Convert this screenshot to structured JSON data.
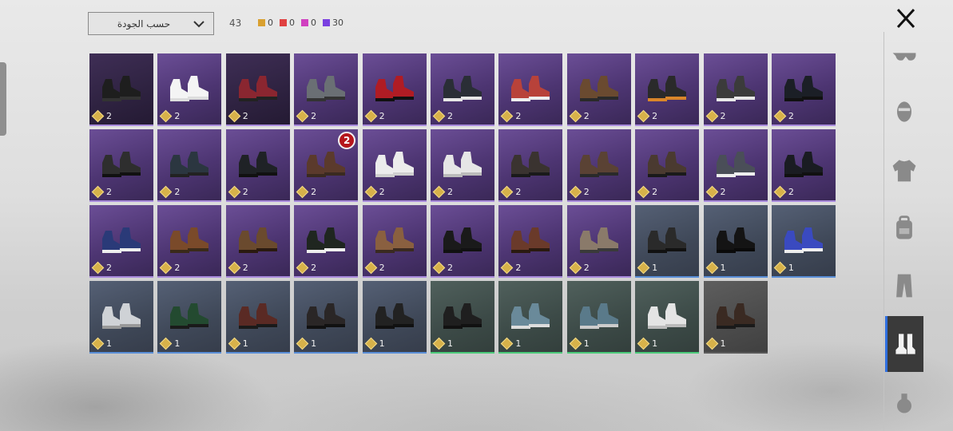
{
  "toolbar": {
    "sort_label": "حسب الجودة",
    "total_count": "43",
    "rarity_counts": [
      {
        "color": "#d9a030",
        "value": "0"
      },
      {
        "color": "#e04040",
        "value": "0"
      },
      {
        "color": "#d040c0",
        "value": "0"
      },
      {
        "color": "#7a40e0",
        "value": "30"
      }
    ]
  },
  "sidebar": {
    "close_icon": "close-icon",
    "categories": [
      {
        "name": "glasses",
        "icon": "glasses-icon",
        "active": false
      },
      {
        "name": "mask",
        "icon": "mask-icon",
        "active": false
      },
      {
        "name": "top",
        "icon": "jacket-icon",
        "active": false
      },
      {
        "name": "backpack",
        "icon": "backpack-icon",
        "active": false
      },
      {
        "name": "pants",
        "icon": "pants-icon",
        "active": false
      },
      {
        "name": "shoes",
        "icon": "shoes-icon",
        "active": true
      },
      {
        "name": "grenade",
        "icon": "grenade-icon",
        "active": false
      }
    ]
  },
  "items": [
    {
      "rarity": "purple-dark",
      "count": "2",
      "color": "#1e1e1e",
      "sole": "#333"
    },
    {
      "rarity": "purple",
      "count": "2",
      "color": "#f4f4f4",
      "sole": "#ddd"
    },
    {
      "rarity": "purple-dark",
      "count": "2",
      "color": "#8a2630",
      "sole": "#222"
    },
    {
      "rarity": "purple",
      "count": "2",
      "color": "#6a6f74",
      "sole": "#333"
    },
    {
      "rarity": "purple",
      "count": "2",
      "color": "#b01c24",
      "sole": "#111"
    },
    {
      "rarity": "purple",
      "count": "2",
      "color": "#2a2e36",
      "sole": "#e6e6e6"
    },
    {
      "rarity": "purple",
      "count": "2",
      "color": "#b8423a",
      "sole": "#eee"
    },
    {
      "rarity": "purple",
      "count": "2",
      "color": "#6a4a30",
      "sole": "#2a2a2a"
    },
    {
      "rarity": "purple",
      "count": "2",
      "color": "#2a2a2a",
      "sole": "#d9862a"
    },
    {
      "rarity": "purple",
      "count": "2",
      "color": "#3b3b3b",
      "sole": "#e8e8e8"
    },
    {
      "rarity": "purple",
      "count": "2",
      "color": "#1b1f26",
      "sole": "#111"
    },
    {
      "rarity": "purple",
      "count": "2",
      "color": "#2e2e2e",
      "sole": "#111"
    },
    {
      "rarity": "purple",
      "count": "2",
      "color": "#2b3640",
      "sole": "#222"
    },
    {
      "rarity": "purple",
      "count": "2",
      "color": "#1f2226",
      "sole": "#111"
    },
    {
      "rarity": "purple",
      "count": "2",
      "color": "#5b3a2c",
      "sole": "#3a2a20",
      "badge": "2"
    },
    {
      "rarity": "purple",
      "count": "2",
      "color": "#ececec",
      "sole": "#cfcfcf"
    },
    {
      "rarity": "purple",
      "count": "2",
      "color": "#e6e6e6",
      "sole": "#bbb"
    },
    {
      "rarity": "purple",
      "count": "2",
      "color": "#3a3330",
      "sole": "#1a1a1a"
    },
    {
      "rarity": "purple",
      "count": "2",
      "color": "#5a4234",
      "sole": "#2a2a2a"
    },
    {
      "rarity": "purple",
      "count": "2",
      "color": "#4a3a30",
      "sole": "#1a1a1a"
    },
    {
      "rarity": "purple",
      "count": "2",
      "color": "#4a4e58",
      "sole": "#eee"
    },
    {
      "rarity": "purple",
      "count": "2",
      "color": "#1a1c22",
      "sole": "#111"
    },
    {
      "rarity": "purple",
      "count": "2",
      "color": "#2a3a78",
      "sole": "#eee"
    },
    {
      "rarity": "purple",
      "count": "2",
      "color": "#7a4a2a",
      "sole": "#3a2a1a"
    },
    {
      "rarity": "purple",
      "count": "2",
      "color": "#6a4a2e",
      "sole": "#2a1a10"
    },
    {
      "rarity": "purple",
      "count": "2",
      "color": "#1f2620",
      "sole": "#eee"
    },
    {
      "rarity": "purple",
      "count": "2",
      "color": "#8a6040",
      "sole": "#3a2a20"
    },
    {
      "rarity": "purple",
      "count": "2",
      "color": "#1a1a1a",
      "sole": "#111"
    },
    {
      "rarity": "purple",
      "count": "2",
      "color": "#6a3a2a",
      "sole": "#2a1a10"
    },
    {
      "rarity": "purple",
      "count": "2",
      "color": "#8a7a6a",
      "sole": "#3a3a3a"
    },
    {
      "rarity": "blue",
      "count": "1",
      "color": "#2a2a2a",
      "sole": "#111"
    },
    {
      "rarity": "blue",
      "count": "1",
      "color": "#141414",
      "sole": "#0a0a0a"
    },
    {
      "rarity": "blue",
      "count": "1",
      "color": "#3a4ac0",
      "sole": "#eee"
    },
    {
      "rarity": "blue",
      "count": "1",
      "color": "#cfd2d6",
      "sole": "#999"
    },
    {
      "rarity": "blue",
      "count": "1",
      "color": "#234a30",
      "sole": "#1a1a1a"
    },
    {
      "rarity": "blue",
      "count": "1",
      "color": "#5a2a24",
      "sole": "#1a1a1a"
    },
    {
      "rarity": "blue",
      "count": "1",
      "color": "#2a2626",
      "sole": "#111"
    },
    {
      "rarity": "blue",
      "count": "1",
      "color": "#222222",
      "sole": "#111"
    },
    {
      "rarity": "green",
      "count": "1",
      "color": "#1f1f1f",
      "sole": "#111"
    },
    {
      "rarity": "green",
      "count": "1",
      "color": "#6a8a9a",
      "sole": "#ddd"
    },
    {
      "rarity": "green",
      "count": "1",
      "color": "#5a7a8a",
      "sole": "#ccc"
    },
    {
      "rarity": "green",
      "count": "1",
      "color": "#e4e4e4",
      "sole": "#bbb"
    },
    {
      "rarity": "grey",
      "count": "1",
      "color": "#3a2a22",
      "sole": "#1a1a1a"
    }
  ]
}
